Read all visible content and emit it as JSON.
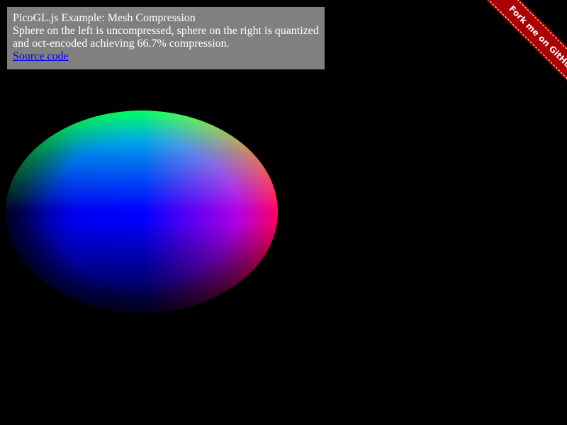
{
  "info": {
    "title": "PicoGL.js Example: Mesh Compression",
    "description": "Sphere on the left is uncompressed, sphere on the right is quantized and oct-encoded achieving 66.7% compression.",
    "source_link": "Source code"
  },
  "ribbon": {
    "label": "Fork me on GitHub",
    "color": "#aa0000"
  },
  "colors": {
    "background": "#000000",
    "panel": "#808080",
    "link": "#0000ee"
  }
}
